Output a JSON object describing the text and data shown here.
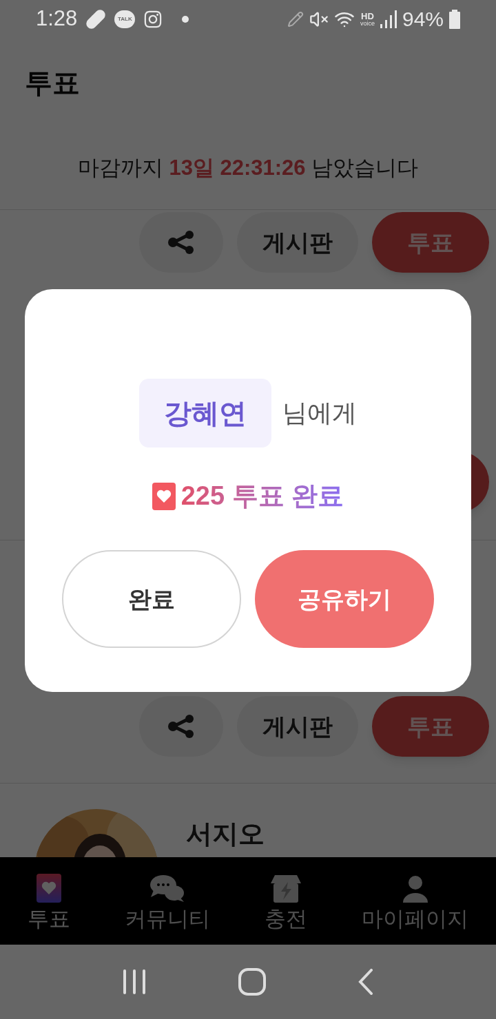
{
  "status_bar": {
    "time": "1:28",
    "talk_label": "TALK",
    "hd_label": "HD",
    "voice_label": "voice",
    "battery": "94%"
  },
  "header": {
    "title": "투표"
  },
  "countdown": {
    "prefix": "마감까지",
    "remaining": "13일 22:31:26",
    "suffix": "남았습니다"
  },
  "candidates": [
    {
      "kind": "actions",
      "board": "게시판",
      "vote": "투표"
    },
    {
      "kind": "actions",
      "board": "게시판",
      "vote": "투표"
    },
    {
      "kind": "profile",
      "name": "서지오"
    }
  ],
  "dialog": {
    "name": "강혜연",
    "name_suffix": "님에게",
    "votes": "225 투표 완료",
    "buttons": [
      {
        "label": "완료",
        "kind": "outline"
      },
      {
        "label": "공유하기",
        "kind": "primary"
      }
    ]
  },
  "bottom_nav": [
    {
      "label": "투표",
      "kind": "heart",
      "selected": true
    },
    {
      "label": "커뮤니티",
      "kind": "chat",
      "selected": false
    },
    {
      "label": "충전",
      "kind": "store",
      "selected": false
    },
    {
      "label": "마이페이지",
      "kind": "user",
      "selected": false
    }
  ]
}
